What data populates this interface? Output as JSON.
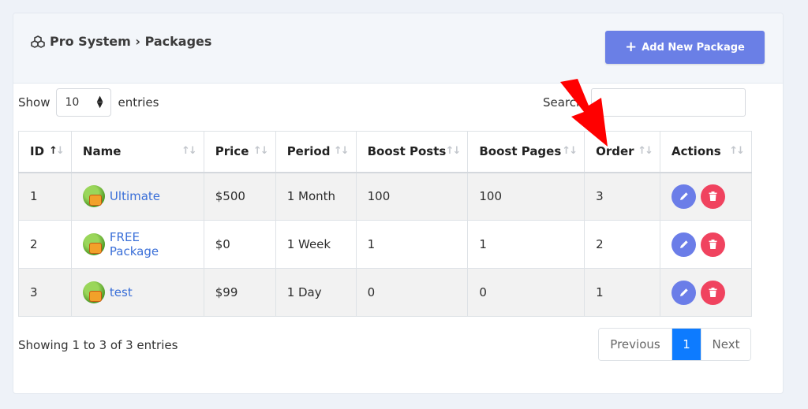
{
  "header": {
    "breadcrumb": "Pro System › Packages",
    "add_button_label": "Add New Package"
  },
  "length_control": {
    "prefix": "Show",
    "value": "10",
    "suffix": "entries"
  },
  "search": {
    "label": "Search:"
  },
  "table": {
    "columns": [
      "ID",
      "Name",
      "Price",
      "Period",
      "Boost Posts",
      "Boost Pages",
      "Order",
      "Actions"
    ],
    "rows": [
      {
        "id": "1",
        "name": "Ultimate",
        "price": "$500",
        "period": "1 Month",
        "boost_posts": "100",
        "boost_pages": "100",
        "order": "3"
      },
      {
        "id": "2",
        "name": "FREE Package",
        "price": "$0",
        "period": "1 Week",
        "boost_posts": "1",
        "boost_pages": "1",
        "order": "2"
      },
      {
        "id": "3",
        "name": "test",
        "price": "$99",
        "period": "1 Day",
        "boost_posts": "0",
        "boost_pages": "0",
        "order": "1"
      }
    ]
  },
  "footer": {
    "info": "Showing 1 to 3 of 3 entries",
    "previous": "Previous",
    "current_page": "1",
    "next": "Next"
  },
  "colors": {
    "accent": "#6a7fe6",
    "edit": "#6b7de8",
    "delete": "#f0435f",
    "page_active": "#0d7bff",
    "annotation_arrow": "#ff0000"
  },
  "icons": [
    "cubes-icon",
    "plus-icon",
    "sort-icon",
    "package-icon",
    "pencil-icon",
    "trash-icon",
    "annotation-arrow"
  ]
}
